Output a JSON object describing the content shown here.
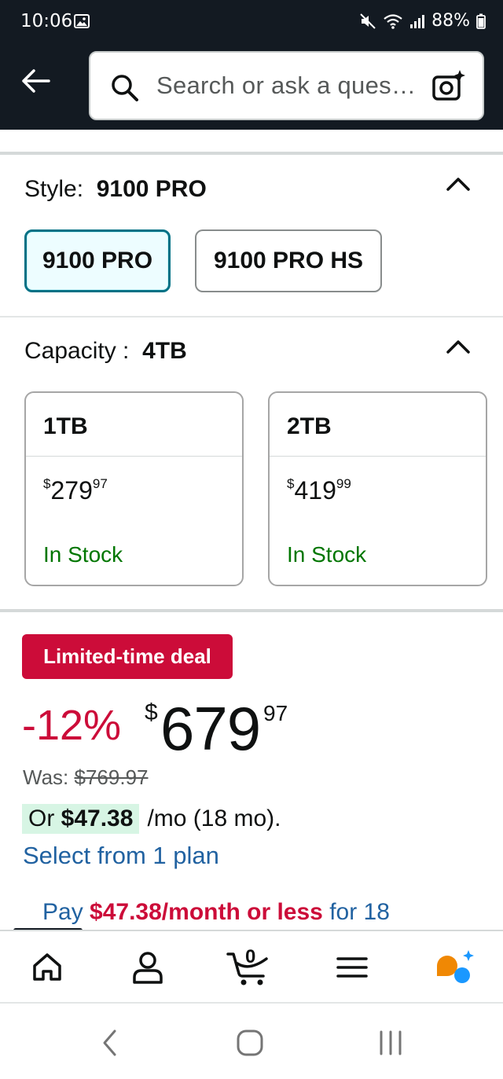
{
  "status_bar": {
    "time": "10:06",
    "battery": "88%",
    "icons": [
      "image-icon",
      "mute-icon",
      "wifi-icon",
      "signal-icon",
      "battery-icon"
    ]
  },
  "header": {
    "search_placeholder": "Search or ask a ques…",
    "icons": [
      "back-arrow-icon",
      "search-icon",
      "camera-search-icon"
    ]
  },
  "style_section": {
    "label": "Style:",
    "selected_value": "9100 PRO",
    "options": [
      {
        "label": "9100 PRO",
        "selected": true
      },
      {
        "label": "9100 PRO HS",
        "selected": false
      }
    ]
  },
  "capacity_section": {
    "label": "Capacity :",
    "selected_value": "4TB",
    "options": [
      {
        "title": "1TB",
        "currency": "$",
        "whole": "279",
        "fraction": "97",
        "stock": "In Stock"
      },
      {
        "title": "2TB",
        "currency": "$",
        "whole": "419",
        "fraction": "99",
        "stock": "In Stock"
      }
    ]
  },
  "deal": {
    "badge": "Limited-time deal",
    "discount": "-12%",
    "currency": "$",
    "price_whole": "679",
    "price_fraction": "97",
    "was_label": "Was:",
    "was_price": "$769.97",
    "monthly_prefix": "Or",
    "monthly_amount": "$47.38",
    "monthly_suffix": "/mo (18 mo).",
    "plan_link": "Select from 1 plan",
    "pay_prefix": "Pay",
    "pay_amount": "$47.38/month or less",
    "pay_suffix": "for 18"
  },
  "bottom_nav": {
    "cart_count": "0",
    "items": [
      "home-icon",
      "account-icon",
      "cart-icon",
      "menu-icon",
      "rufus-assistant-icon"
    ]
  },
  "system_nav": [
    "back-icon",
    "home-circle-icon",
    "recents-icon"
  ],
  "colors": {
    "header_bg": "#131a22",
    "deal_red": "#cc0c39",
    "link_blue": "#2162a1",
    "stock_green": "#007600",
    "selected_teal": "#007185"
  }
}
